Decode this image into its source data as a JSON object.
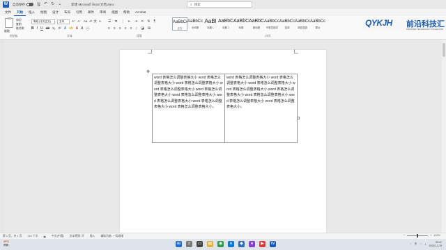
{
  "titlebar": {
    "autosave_label": "自动保存",
    "toggle_state": "关",
    "document_title": "新建 Microsoft Word 文档.docx",
    "search_placeholder": "搜索"
  },
  "tabs": [
    "文件",
    "开始",
    "插入",
    "绘图",
    "设计",
    "布局",
    "引用",
    "邮件",
    "审阅",
    "视图",
    "帮助",
    "Acrobat"
  ],
  "active_tab": "开始",
  "ribbon": {
    "clipboard": {
      "paste": "粘贴",
      "cut": "剪切",
      "copy": "复制",
      "format_painter": "格式刷",
      "group": "剪贴板"
    },
    "font": {
      "name": "等线 (中文正文)",
      "size": "五号",
      "group": "字体"
    },
    "paragraph": {
      "group": "段落"
    },
    "styles_group": "样式",
    "styles": [
      {
        "sample": "AaBbCcDd",
        "name": "正文"
      },
      {
        "sample": "AaBbCcDd",
        "name": "无间隔"
      },
      {
        "sample": "AaBl",
        "name": "标题 1"
      },
      {
        "sample": "AaBbC",
        "name": "标题 2"
      },
      {
        "sample": "AaBbC",
        "name": "标题"
      },
      {
        "sample": "AaBbC",
        "name": "副标题"
      },
      {
        "sample": "AaBbCcDd",
        "name": "不明显强调"
      },
      {
        "sample": "AaBbCcDd",
        "name": "强调"
      },
      {
        "sample": "AaBbCcDd",
        "name": "明显强调"
      },
      {
        "sample": "AaBbCcDd",
        "name": "要点"
      }
    ]
  },
  "logo": {
    "mark": "QYKJH",
    "cn": "前沿科技汇",
    "sub": "FRONTIER TECHNOLOGY COLLECTION"
  },
  "document": {
    "cell_left": "word 表格怎么调整表格大小 word 表格怎么调整表格大小 word 表格怎么调整表格大小 word 表格怎么调整表格大小 word 表格怎么调整表格大小 word 表格怎么调整表格大小 word 表格怎么调整表格大小 word 表格怎么调整表格大小 word 表格怎么调整表格大小。",
    "cell_right": "word 表格怎么调整表格大小 word 表格怎么调整表格大小 word 表格怎么调整表格大小 word 表格怎么调整表格大小 word 表格怎么调整表格大小 word 表格怎么调整表格大小 word 表格怎么调整表格大小 word 表格怎么调整表格大小。"
  },
  "statusbar": {
    "page": "第 1 页，共 1 页",
    "words": "210 个字",
    "language": "中文(中国)",
    "text_predictions": "文本预测: 开",
    "insert": "插入",
    "accessibility": "辅助功能: 一切就绪",
    "zoom": "100%"
  },
  "taskbar": {
    "weather_temp": "25°C",
    "weather_desc": "晴朗",
    "tray_lang": "中",
    "time": "20:47",
    "date": "2024-12-19"
  }
}
